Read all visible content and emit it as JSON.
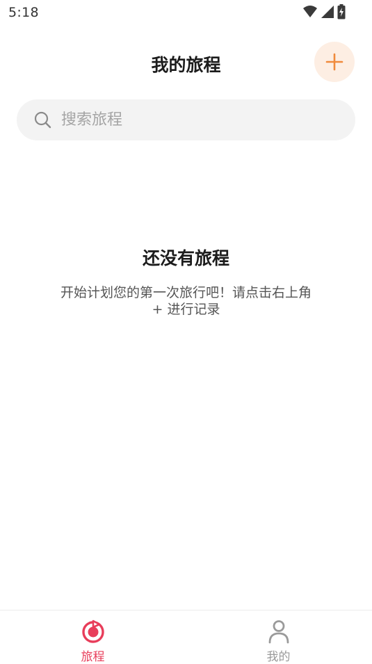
{
  "status_bar": {
    "time": "5:18",
    "icons": [
      "wifi-icon",
      "cellular-signal-icon",
      "battery-charging-icon"
    ]
  },
  "header": {
    "title": "我的旅程",
    "add_icon": "plus-icon"
  },
  "search": {
    "placeholder": "搜索旅程",
    "value": "",
    "icon": "search-icon"
  },
  "empty_state": {
    "title": "还没有旅程",
    "description_line1": "开始计划您的第一次旅行吧！请点击右上角",
    "description_line2": "+ 进行记录"
  },
  "bottom_nav": {
    "items": [
      {
        "label": "旅程",
        "icon": "trip-icon",
        "active": true
      },
      {
        "label": "我的",
        "icon": "person-icon",
        "active": false
      }
    ]
  },
  "colors": {
    "accent": "#f08a3c",
    "accent_bg": "#fdeee3",
    "nav_active": "#e83d5a",
    "nav_inactive": "#9a9a9a",
    "search_bg": "#f3f3f3"
  }
}
